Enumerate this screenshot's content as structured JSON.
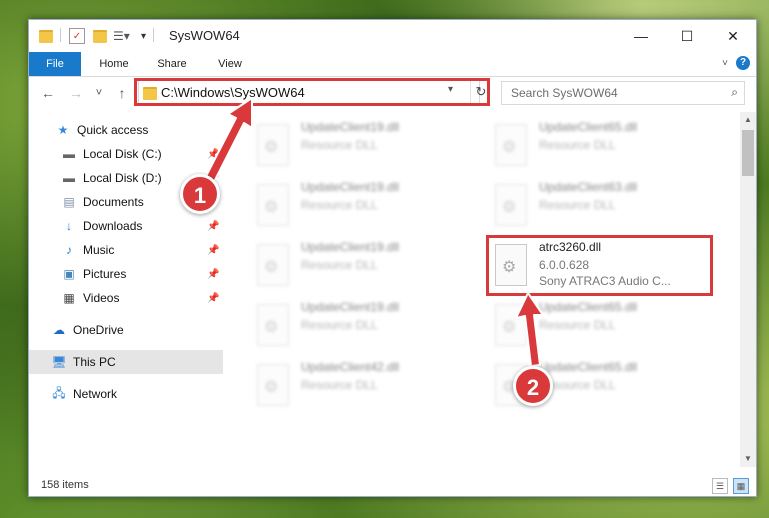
{
  "window": {
    "title": "SysWOW64",
    "controls": {
      "minimize": "—",
      "maximize": "☐",
      "close": "✕"
    }
  },
  "ribbon": {
    "tabs": [
      "File",
      "Home",
      "Share",
      "View"
    ],
    "help": "?"
  },
  "nav": {
    "back": "←",
    "forward": "→",
    "recent": "˅",
    "up": "↑",
    "address": "C:\\Windows\\SysWOW64",
    "refresh": "↻",
    "search_placeholder": "Search SysWOW64"
  },
  "sidebar": {
    "items": [
      {
        "label": "Quick access",
        "icon": "star-icon"
      },
      {
        "label": "Local Disk (C:)",
        "icon": "drive-icon",
        "pinned": true
      },
      {
        "label": "Local Disk (D:)",
        "icon": "drive-icon",
        "pinned": true
      },
      {
        "label": "Documents",
        "icon": "document-icon",
        "pinned": true
      },
      {
        "label": "Downloads",
        "icon": "download-icon",
        "pinned": true
      },
      {
        "label": "Music",
        "icon": "music-icon",
        "pinned": true
      },
      {
        "label": "Pictures",
        "icon": "picture-icon",
        "pinned": true
      },
      {
        "label": "Videos",
        "icon": "video-icon",
        "pinned": true
      },
      {
        "label": "OneDrive",
        "icon": "cloud-icon"
      },
      {
        "label": "This PC",
        "icon": "computer-icon",
        "selected": true
      },
      {
        "label": "Network",
        "icon": "network-icon"
      }
    ]
  },
  "files": {
    "blurred": [
      {
        "name": "UpdateClient19.dll",
        "type": "Resource DLL"
      },
      {
        "name": "UpdateClient65.dll",
        "type": "Resource DLL"
      },
      {
        "name": "UpdateClient19.dll",
        "type": "Resource DLL"
      },
      {
        "name": "UpdateClient63.dll",
        "type": "Resource DLL"
      },
      {
        "name": "UpdateClient19.dll",
        "type": "Resource DLL"
      },
      {
        "name": "UpdateClient19.dll",
        "type": "Resource DLL"
      },
      {
        "name": "UpdateClient65.dll",
        "type": "Resource DLL"
      },
      {
        "name": "UpdateClient42.dll",
        "type": "Resource DLL"
      },
      {
        "name": "UpdateClient65.dll",
        "type": "Resource DLL"
      }
    ],
    "highlighted": {
      "name": "atrc3260.dll",
      "version": "6.0.0.628",
      "description": "Sony ATRAC3 Audio C..."
    }
  },
  "status": {
    "item_count": "158 items"
  },
  "annotations": {
    "badge1": "1",
    "badge2": "2",
    "color": "#d9393b"
  }
}
